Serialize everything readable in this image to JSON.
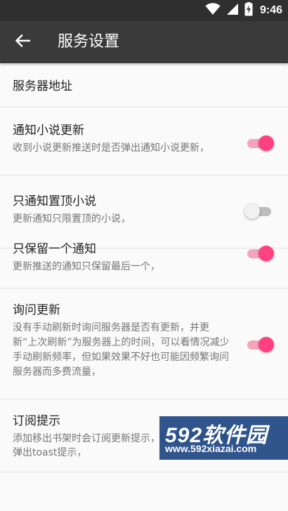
{
  "status_bar": {
    "time": "9:46"
  },
  "toolbar": {
    "title": "服务设置"
  },
  "settings": [
    {
      "title": "服务器地址"
    },
    {
      "title": "通知小说更新",
      "summary": "收到小说更新推送时是否弹出通知小说更新，",
      "enabled": true
    },
    {
      "title": "只通知置顶小说",
      "summary": "更新通知只限置顶的小说，",
      "enabled": false
    },
    {
      "title": "只保留一个通知",
      "summary": "更新推送的通知只保留最后一个，",
      "enabled": true
    },
    {
      "title": "询问更新",
      "summary": "没有手动刷新时询问服务器是否有更新，并更新“上次刷新”为服务器上的时间，可以看情况减少手动刷新频率，但如果效果不好也可能因频繁询问服务器而多费流量，",
      "enabled": true
    },
    {
      "title": "订阅提示",
      "summary": "添加移出书架时会订阅更新提示，订阅成功时是否弹出toast提示，",
      "enabled": null
    }
  ],
  "watermark": {
    "logo": "592软件园",
    "url": "www.592xiazai.com"
  },
  "colors": {
    "accent": "#ff4081",
    "toolbar": "#3a3a3a",
    "statusbar": "#2f2f2f"
  },
  "icons": {
    "back": "arrow-left-icon",
    "wifi": "wifi-icon",
    "signal": "signal-icon",
    "battery": "battery-charging-icon"
  }
}
